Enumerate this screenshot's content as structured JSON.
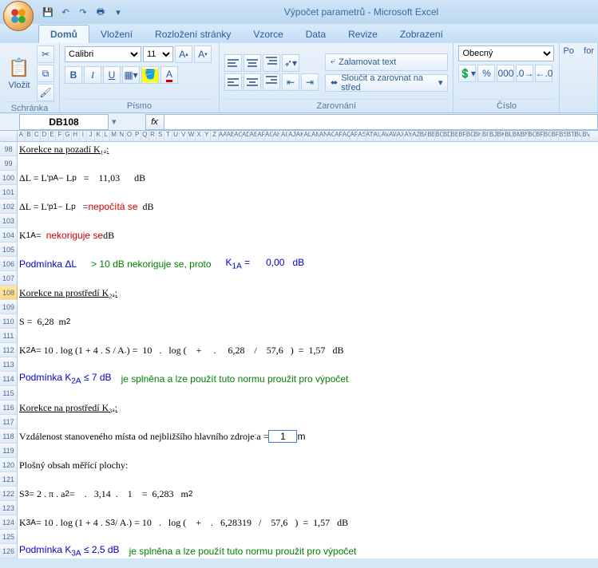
{
  "title": "Výpočet parametrů - Microsoft Excel",
  "tabs": [
    "Domů",
    "Vložení",
    "Rozložení stránky",
    "Vzorce",
    "Data",
    "Revize",
    "Zobrazení"
  ],
  "active_tab": 0,
  "clipboard": {
    "paste": "Vložit",
    "label": "Schránka"
  },
  "font": {
    "name": "Calibri",
    "size": "11",
    "label": "Písmo",
    "bold": "B",
    "italic": "I",
    "underline": "U"
  },
  "align": {
    "wrap": "Zalamovat text",
    "merge": "Sloučit a zarovnat na střed",
    "label": "Zarovnání"
  },
  "number": {
    "format": "Obecný",
    "label": "Číslo"
  },
  "right_cut": "Po    for",
  "namebox": "DB108",
  "fx": "fx",
  "colheaders": [
    "A",
    "B",
    "C",
    "D",
    "E",
    "F",
    "G",
    "H",
    "I",
    "J",
    "K",
    "L",
    "M",
    "N",
    "O",
    "P",
    "Q",
    "R",
    "S",
    "T",
    "U",
    "V",
    "W",
    "X",
    "Y",
    "Z",
    "AA",
    "AB",
    "AC",
    "AD",
    "AE",
    "AF",
    "AG",
    "AH",
    "AI",
    "AJ",
    "AK",
    "AL",
    "AM",
    "AN",
    "AO",
    "AP",
    "AQ",
    "AR",
    "AS",
    "AT",
    "AU",
    "AV",
    "AW",
    "AX",
    "AY",
    "AZ",
    "BA",
    "BB",
    "BC",
    "BD",
    "BE",
    "BF",
    "BG",
    "BH",
    "BI",
    "BJ",
    "BK",
    "BL",
    "BM",
    "BN",
    "BO",
    "BP",
    "BQ",
    "BR",
    "BS",
    "BT",
    "BU",
    "BV"
  ],
  "rows": {
    "98": {
      "text": "Korekce na pozadí K₁ₐ:",
      "cls": "u"
    },
    "99": {
      "text": ""
    },
    "100": {
      "html": "ΔL = L'<sub>pA</sub> − L<sub>p</sub>&nbsp;&nbsp;&nbsp;=&nbsp;&nbsp;&nbsp;&nbsp;11,03&nbsp;&nbsp;&nbsp;&nbsp;&nbsp;&nbsp;dB"
    },
    "101": {
      "text": ""
    },
    "102": {
      "html": "ΔL = L'<sub>p1</sub> − L<sub>p</sub>&nbsp;&nbsp;&nbsp;= <span class='red'>nepočítá se</span>&nbsp;&nbsp;dB"
    },
    "103": {
      "text": ""
    },
    "104": {
      "html": "K<sub>1A</sub> =&nbsp;&nbsp;<span class='red'>nekoriguje se</span> dB"
    },
    "105": {
      "text": ""
    },
    "106": {
      "html": "<span class='blue'>Podmínka ΔL</span>&nbsp;&nbsp;&nbsp;&nbsp;&nbsp;&nbsp;<span class='green'>&gt; 10 dB nekoriguje se, proto</span>&nbsp;&nbsp;&nbsp;&nbsp;&nbsp;&nbsp;<span class='blue'>K<sub>1A</sub> =&nbsp;&nbsp;&nbsp;&nbsp;&nbsp;&nbsp;0,00&nbsp;&nbsp;&nbsp;dB</span>"
    },
    "107": {
      "text": ""
    },
    "108": {
      "text": "Korekce na prostředí K₂ₐ:",
      "cls": "u",
      "sel": true
    },
    "109": {
      "text": ""
    },
    "110": {
      "html": "S =&nbsp;&nbsp;6,28&nbsp;&nbsp;m<sup>2</sup>"
    },
    "111": {
      "text": ""
    },
    "112": {
      "html": "K<sub>2A</sub> = 10 . log (1 + 4 . S / A<sub>.</sub>) =&nbsp;&nbsp;10&nbsp;&nbsp;&nbsp;.&nbsp;&nbsp;&nbsp;log&nbsp;(&nbsp;&nbsp;&nbsp;&nbsp;+&nbsp;&nbsp;&nbsp;&nbsp;&nbsp;.&nbsp;&nbsp;&nbsp;&nbsp;&nbsp;6,28&nbsp;&nbsp;&nbsp;&nbsp;/&nbsp;&nbsp;&nbsp;&nbsp;57,6&nbsp;&nbsp;&nbsp;)&nbsp;&nbsp;=&nbsp;&nbsp;1,57&nbsp;&nbsp;&nbsp;dB"
    },
    "113": {
      "text": ""
    },
    "114": {
      "html": "<span class='blue'>Podmínka K<sub>2A</sub> ≤ 7 dB</span>&nbsp;&nbsp;&nbsp;&nbsp;<span class='green'>je splněna a lze použít tuto normu proužit pro výpočet</span>"
    },
    "115": {
      "text": ""
    },
    "116": {
      "text": "Korekce na prostředí K₃ₐ:",
      "cls": "u"
    },
    "117": {
      "text": ""
    },
    "118": {
      "html": "Vzdálenost stanoveného místa od nejbližšího hlavního zdroje <sub>:</sub> a = ",
      "input": "1",
      "after": " m"
    },
    "119": {
      "text": ""
    },
    "120": {
      "text": "Plošný obsah měřící plochy:"
    },
    "121": {
      "text": ""
    },
    "122": {
      "html": "S<sub>3</sub> = 2 . π . a<sup>2</sup> =&nbsp;&nbsp;&nbsp;&nbsp;.&nbsp;&nbsp;&nbsp;3,14&nbsp;&nbsp;.&nbsp;&nbsp;&nbsp;&nbsp;1&nbsp;&nbsp;&nbsp;&nbsp;=&nbsp;&nbsp;6,283&nbsp;&nbsp;&nbsp;m<sup>2</sup>"
    },
    "123": {
      "text": ""
    },
    "124": {
      "html": "K<sub>3A</sub> = 10 . log (1 + 4 . S<sub>3</sub> / A<sub>.</sub>) =&nbsp;10&nbsp;&nbsp;&nbsp;.&nbsp;&nbsp;&nbsp;log&nbsp;(&nbsp;&nbsp;&nbsp;&nbsp;+&nbsp;&nbsp;&nbsp;&nbsp;.&nbsp;&nbsp;&nbsp;6,28319&nbsp;&nbsp;&nbsp;/&nbsp;&nbsp;&nbsp;&nbsp;57,6&nbsp;&nbsp;&nbsp;)&nbsp;&nbsp;=&nbsp;&nbsp;1,57&nbsp;&nbsp;&nbsp;dB"
    },
    "125": {
      "text": ""
    },
    "126": {
      "html": "<span class='blue'>Podmínka K<sub>3A</sub> ≤ 2,5 dB</span>&nbsp;&nbsp;&nbsp;&nbsp;<span class='green'>je splněna a lze použít tuto normu proužit pro výpočet</span>"
    }
  }
}
